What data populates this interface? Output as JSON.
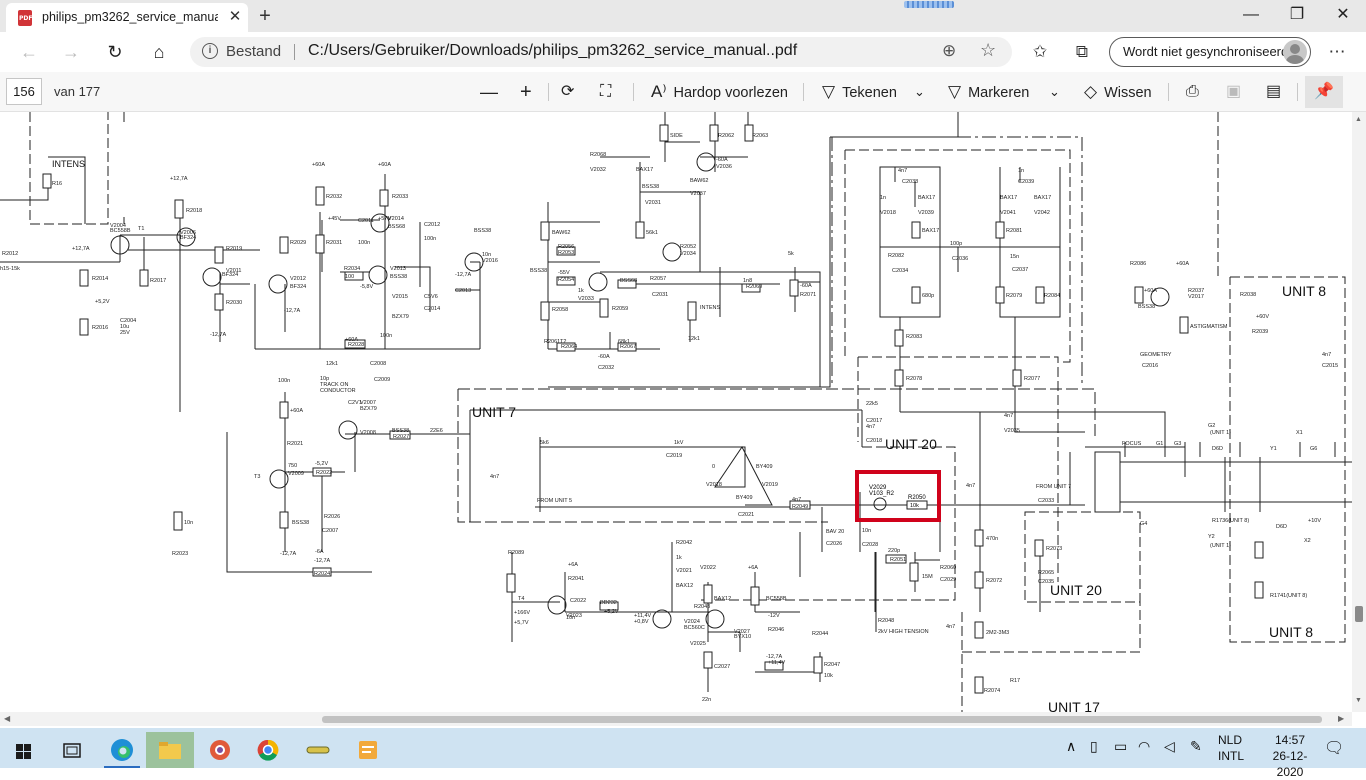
{
  "browser": {
    "tab_title": "philips_pm3262_service_manual..",
    "tab_close": "✕",
    "new_tab": "+",
    "window": {
      "minimize": "—",
      "restore": "❐",
      "close": "✕"
    },
    "security_label": "Bestand",
    "url": "C:/Users/Gebruiker/Downloads/philips_pm3262_service_manual..pdf",
    "sync_label": "Wordt niet gesynchroniseerd"
  },
  "pdf_toolbar": {
    "page_number": "156",
    "page_of": "van 177",
    "read_aloud": "Hardop voorlezen",
    "draw": "Tekenen",
    "highlight": "Markeren",
    "erase": "Wissen"
  },
  "schematic": {
    "unit_labels": [
      "UNIT 7",
      "UNIT 20",
      "UNIT 20",
      "UNIT 8",
      "UNIT 8",
      "UNIT 17"
    ],
    "intens_label": "INTENS",
    "highlight_color": "#d0021b",
    "highlighted_component": {
      "ref": "V2029",
      "type": "V103_R2",
      "resistor": "R2050",
      "resistor_value": "10k"
    },
    "labels": [
      "R16",
      "R2012",
      "h15-15k",
      "+12,7A",
      "V2004",
      "BC558B",
      "R2014",
      "+5,2V",
      "R2016",
      "C2004",
      "10u",
      "25V",
      "R2017",
      "T1",
      "+12,7A",
      "R2018",
      "V2006",
      "BF324",
      "R2019",
      "V2011",
      "BF324",
      "R2030",
      "-12,7A",
      "+60A",
      "R2029",
      "V2012",
      "BF324",
      "-12,7A",
      "+60A",
      "R2032",
      "R2031",
      "+45V",
      "R2033",
      "V2014",
      "BSS68",
      "+57V",
      "C2011",
      "100n",
      "C2012",
      "100n",
      "R2034",
      "100",
      "-5,8V",
      "V2013",
      "BSS38",
      "V2015",
      "BZX79",
      "C5V6",
      "C2014",
      "100n",
      "-12,7A",
      "C2013",
      "10n",
      "V2016",
      "BSS38",
      "+60A",
      "R2028",
      "12k1",
      "C2008",
      "C2009",
      "10p",
      "TRACK ON",
      "CONDUCTOR",
      "SIDE",
      "R2062",
      "R2063",
      "R2068",
      "V2032",
      "BAX17",
      "-60A",
      "V2036",
      "BSS38",
      "V2031",
      "BAW62",
      "V2037",
      "BAW62",
      "R2056",
      "R2053",
      "56k1",
      "R2052",
      "V2034",
      "BSS38",
      "-55V",
      "R2054",
      "1k",
      "V2033",
      "BSS68",
      "R2059",
      "R2058",
      "R2057",
      "C2031",
      "1n8",
      "R2069",
      "5k",
      "-60A",
      "R2071",
      "INTENS",
      "R2061",
      "T2",
      "R2064",
      "68k1",
      "R2067",
      "12k1",
      "-60A",
      "C2032",
      "4n7",
      "C2038",
      "1n",
      "C2039",
      "1n",
      "V2018",
      "BAX17",
      "V2039",
      "BAX17",
      "V2041",
      "BAX17",
      "V2042",
      "BAX17",
      "R2081",
      "R2082",
      "C2034",
      "100p",
      "C2036",
      "15n",
      "C2037",
      "680p",
      "R2079",
      "R2084",
      "R2083",
      "R2078",
      "R2077",
      "R2086",
      "+60A",
      "+60A",
      "R2037",
      "V2017",
      "BSS38",
      "ASTIGMATISM",
      "R2038",
      "+60V",
      "R2039",
      "GEOMETRY",
      "C2016",
      "4n7",
      "C2015",
      "100n",
      "+60A",
      "R2021",
      "V2007",
      "BZX79",
      "C2V1",
      "V2008",
      "BSS38",
      "R2027",
      "22E6",
      "T3",
      "-5,2V",
      "R2022",
      "750",
      "V2009",
      "BSS38",
      "R2026",
      "C2007",
      "10n",
      "R2023",
      "-12,7A",
      "-6A",
      "-12,7A",
      "R2024",
      "5k6",
      "1kV",
      "C2019",
      "4n7",
      "FROM UNIT 5",
      "0",
      "V2018",
      "BY409",
      "V2019",
      "BY409",
      "C2021",
      "4n7",
      "R2049",
      "22k5",
      "C2017",
      "4n7",
      "C2018",
      "4n7",
      "V2035",
      "BAV 20",
      "C2026",
      "10n",
      "C2028",
      "220p",
      "R2051",
      "15M",
      "R2060",
      "C2029",
      "4n7",
      "FROM UNIT 7",
      "C2033",
      "470n",
      "R2072",
      "R2073",
      "R2065",
      "C2035",
      "4n7",
      "2M2-3M3",
      "R2074",
      "R17",
      "FOCUS",
      "G1",
      "G3",
      "G4",
      "G2",
      "(UNIT 1)",
      "D6D",
      "Y1",
      "G6",
      "X1",
      "R1736(UNIT 8)",
      "Y2",
      "(UNIT 1)",
      "D6D",
      "+10V",
      "X2",
      "R1741(UNIT 8)",
      "R2089",
      "+6A",
      "R2041",
      "T4",
      "+166V",
      "+5,7V",
      "C2022",
      "10n",
      "V2023",
      "BD232",
      "+5,2V",
      "R2042",
      "1k",
      "V2021",
      "BAX12",
      "V2022",
      "BAX12",
      "+6A",
      "R2043",
      "+11,4V",
      "+0,8V",
      "V2024",
      "BC560C",
      "V2025",
      "BC558B",
      "-12V",
      "R2046",
      "V2027",
      "BYX10",
      "C2027",
      "22n",
      "R2044",
      "-12,7A",
      "+11,4V",
      "R2047",
      "10k",
      "R2048",
      "2kV HIGH TENSION",
      "C2030",
      "10n"
    ]
  },
  "taskbar": {
    "apps": [
      "start-icon",
      "task-view-icon",
      "edge-icon",
      "file-explorer-icon",
      "chrome-alt-icon",
      "chrome-icon",
      "keys-icon",
      "notes-icon"
    ],
    "lang_line1": "NLD",
    "lang_line2": "INTL",
    "time": "14:57",
    "date": "26-12-2020"
  }
}
